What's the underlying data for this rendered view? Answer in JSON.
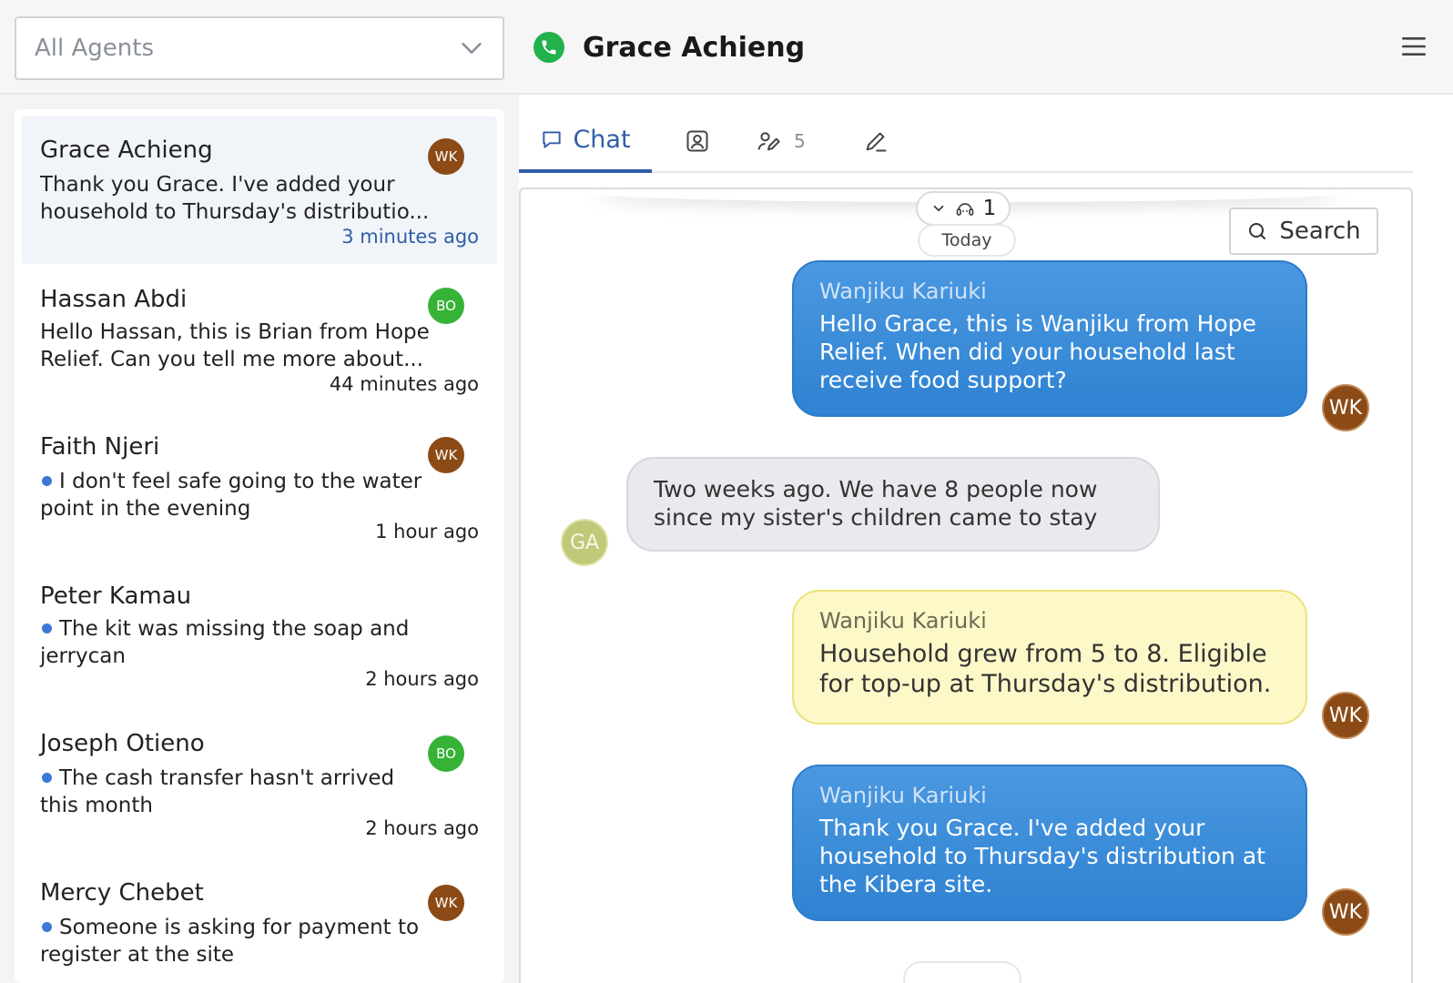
{
  "agent_filter": {
    "value": "All Agents",
    "icon": "chevron-down-icon"
  },
  "header": {
    "contact_name": "Grace Achieng",
    "status_icon": "phone-icon",
    "menu_icon": "hamburger-menu-icon"
  },
  "conversations": [
    {
      "name": "Grace Achieng",
      "preview": "Thank you Grace. I've added your household to Thursday's distributio...",
      "time": "3 minutes ago",
      "agent": "WK",
      "agent_color": "#8b4a16",
      "unread": false,
      "active": true
    },
    {
      "name": "Hassan Abdi",
      "preview": "Hello Hassan, this is Brian from Hope Relief. Can you tell me more about...",
      "time": "44 minutes ago",
      "agent": "BO",
      "agent_color": "#36b336",
      "unread": false,
      "active": false
    },
    {
      "name": "Faith Njeri",
      "preview": "I don't feel safe going to the water point in the evening",
      "time": "1 hour ago",
      "agent": "WK",
      "agent_color": "#8b4a16",
      "unread": true,
      "active": false
    },
    {
      "name": "Peter Kamau",
      "preview": "The kit was missing the soap and jerrycan",
      "time": "2 hours ago",
      "agent": null,
      "agent_color": null,
      "unread": true,
      "active": false
    },
    {
      "name": "Joseph Otieno",
      "preview": "The cash transfer hasn't arrived this month",
      "time": "2 hours ago",
      "agent": "BO",
      "agent_color": "#36b336",
      "unread": true,
      "active": false
    },
    {
      "name": "Mercy Chebet",
      "preview": "Someone is asking for payment to register at the site",
      "time": "",
      "agent": "WK",
      "agent_color": "#8b4a16",
      "unread": true,
      "active": false
    }
  ],
  "tabs": [
    {
      "label": "Chat",
      "icon": "chat-bubble-icon",
      "active": true
    },
    {
      "label": "",
      "icon": "contact-card-icon",
      "active": false
    },
    {
      "label": "",
      "icon": "assign-user-icon",
      "count": "5",
      "active": false
    },
    {
      "label": "",
      "icon": "pencil-icon",
      "active": false
    }
  ],
  "chat": {
    "collapsed_count": "1",
    "date_label": "Today",
    "search_label": "Search",
    "messages": [
      {
        "type": "outgoing",
        "author": "Wanjiku Kariuki",
        "text": "Hello Grace, this is Wanjiku from Hope Relief. When did your household last receive food support?",
        "avatar": "WK"
      },
      {
        "type": "incoming",
        "author": "",
        "text": "Two weeks ago. We have 8 people now since my sister's children came to stay",
        "avatar": "GA"
      },
      {
        "type": "note",
        "author": "Wanjiku Kariuki",
        "text": "Household grew from 5 to 8. Eligible for top-up at Thursday's distribution.",
        "avatar": "WK"
      },
      {
        "type": "outgoing",
        "author": "Wanjiku Kariuki",
        "text": "Thank you Grace. I've added your household to Thursday's distribution at the Kibera site.",
        "avatar": "WK"
      }
    ]
  },
  "colors": {
    "accent": "#2f5ea8",
    "bubble_out": "#3a8ad8",
    "bubble_note": "#fdf8c8",
    "bubble_in": "#e9eaee",
    "online": "#22b14c"
  }
}
